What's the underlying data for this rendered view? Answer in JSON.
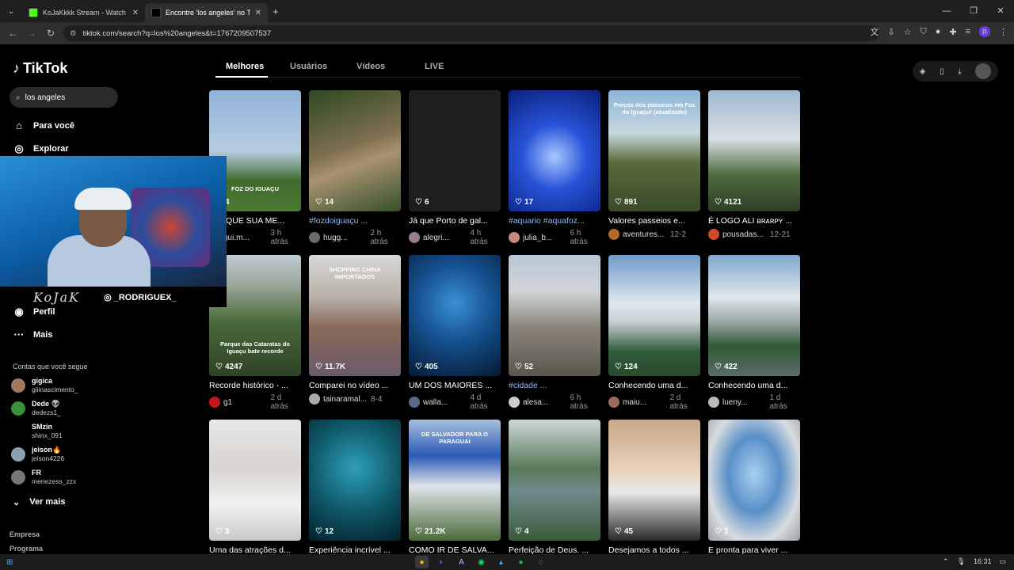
{
  "browser": {
    "tabs": [
      {
        "title": "KoJaKkkk Stream - Watch Live o",
        "favicon_color": "#53fc18"
      },
      {
        "title": "Encontre 'los angeles' no TikTok",
        "favicon_color": "#000000"
      }
    ],
    "url": "tiktok.com/search?q=los%20angeles&t=1767209507537",
    "profile_initial": "R"
  },
  "sidebar": {
    "brand": "TikTok",
    "search_value": "los angeles",
    "nav": [
      {
        "label": "Para você",
        "icon": "home-icon"
      },
      {
        "label": "Explorar",
        "icon": "compass-icon"
      },
      {
        "label": "Perfil",
        "icon": "user-icon"
      },
      {
        "label": "Mais",
        "icon": "more-icon"
      }
    ],
    "following_title": "Contas que você segue",
    "accounts": [
      {
        "name": "gigica",
        "user": "giiinascimento_",
        "color": "#a0775f"
      },
      {
        "name": "Dede 👽",
        "user": "dedezs1_",
        "color": "#3b8f3b"
      },
      {
        "name": "SMzin",
        "user": "shinx_091",
        "color": ""
      },
      {
        "name": "jeison🔥",
        "user": "jeison4226",
        "color": "#8aa0b0"
      },
      {
        "name": "FR",
        "user": "menezess_zzx",
        "color": "#777"
      }
    ],
    "see_more": "Ver mais",
    "footer": [
      "Empresa",
      "Programa"
    ]
  },
  "webcam": {
    "signature": "KoJaK",
    "instagram": "_RODRIGUEX_"
  },
  "search_tabs": [
    "Melhores",
    "Usuários",
    "Vídeos",
    "LIVE"
  ],
  "videos": [
    {
      "likes": "4",
      "caption": "BLOQUE SUA ME...",
      "author": "gui.m...",
      "date": "3 h atrás",
      "tag": false,
      "bg": "linear-gradient(180deg,#8fb3d9 0%,#b8cce0 50%,#3e6b2c 75%,#4c7a34 100%)",
      "overlay": "FOZ DO IGUAÇU",
      "av": "#888"
    },
    {
      "likes": "14",
      "caption": "#fozdoiguaçu ...",
      "author": "hugg...",
      "date": "2 h atrás",
      "tag": true,
      "bg": "linear-gradient(160deg,#2d4a22 0%,#7d6e4e 45%,#a89270 60%,#35502a 100%)",
      "overlay": "",
      "av": "#6a6a6a"
    },
    {
      "likes": "6",
      "caption": "Já que Porto de gal...",
      "author": "alegri...",
      "date": "4 h atrás",
      "tag": false,
      "bg": "#1e1e1e",
      "overlay": "",
      "av": "#9a7c8c"
    },
    {
      "likes": "17",
      "caption": "#aquario #aquafoz...",
      "author": "julia_b...",
      "date": "6 h atrás",
      "tag": true,
      "bg": "radial-gradient(circle at 50% 55%,#a9c8ff 0%,#2753d8 40%,#0a1f7a 100%)",
      "overlay": "",
      "av": "#c48a7a"
    },
    {
      "likes": "891",
      "caption": "Valores passeios e...",
      "author": "aventures...",
      "date": "12-2",
      "tag": false,
      "bg": "linear-gradient(180deg,#8ab4d8 0%,#c8d8e0 35%,#5a6a3a 60%,#3b4a2a 100%)",
      "overlay": "Preços dos passeios em Foz do Iguaçu! (atualizado)",
      "av": "#b06a2a"
    },
    {
      "likes": "4121",
      "caption": "É LOGO ALI ʙʀᴀʀᴘʏ ...",
      "author": "pousadas...",
      "date": "12-21",
      "tag": false,
      "bg": "linear-gradient(180deg,#9fb8cf 0%,#d8e0e4 40%,#4f6b3e 70%,#2d3f26 100%)",
      "overlay": "",
      "av": "#d04a2a"
    },
    {
      "likes": "4247",
      "caption": "Recorde histórico - ...",
      "author": "g1",
      "date": "2 d atrás",
      "tag": false,
      "bg": "linear-gradient(180deg,#c0ccd4 0%,#9aa69a 25%,#4a6a3a 55%,#2e4226 100%)",
      "overlay": "Parque das Cataratas do Iguaçu bate recorde",
      "av": "#c4161c"
    },
    {
      "likes": "11.7K",
      "caption": "Comparei no vídeo ...",
      "author": "tainaramal...",
      "date": "8-4",
      "tag": false,
      "bg": "linear-gradient(180deg,#d8d8d8 0%,#b8b0a8 35%,#8a6a5a 60%,#6a5a6a 100%)",
      "overlay": "SHOPPING CHINA IMPORTADOS",
      "av": "#aaa"
    },
    {
      "likes": "405",
      "caption": "UM DOS MAIORES ...",
      "author": "walla...",
      "date": "4 d atrás",
      "tag": false,
      "bg": "radial-gradient(circle at 50% 40%,#3a8fd8 0%,#15508f 45%,#061a33 100%)",
      "overlay": "",
      "av": "#5a6a8a"
    },
    {
      "likes": "52",
      "caption": "#cidade ...",
      "author": "alesa...",
      "date": "6 h atrás",
      "tag": true,
      "bg": "linear-gradient(180deg,#b8c8d8 0%,#d0d4d8 30%,#8a8478 60%,#5a564e 100%)",
      "overlay": "",
      "av": "#ccc"
    },
    {
      "likes": "124",
      "caption": "Conhecendo uma d...",
      "author": "maiu...",
      "date": "2 d atrás",
      "tag": false,
      "bg": "linear-gradient(180deg,#6f9ac8 0%,#e0e8ee 40%,#c8d0d4 55%,#2f5a3a 80%,#2a4a2e 100%)",
      "overlay": "",
      "av": "#9a6a5a"
    },
    {
      "likes": "422",
      "caption": "Conhecendo uma d...",
      "author": "lueny...",
      "date": "1 d atrás",
      "tag": false,
      "bg": "linear-gradient(180deg,#7fa8d0 0%,#e0e6ea 35%,#9aa8a8 55%,#2f5a34 75%,#5a6a6a 100%)",
      "overlay": "",
      "av": "#bbb"
    },
    {
      "likes": "3",
      "caption": "Uma das atrações d...",
      "author": "",
      "date": "",
      "tag": false,
      "bg": "linear-gradient(180deg,#e8e8e8 0%,#d8d4d0 40%,#f2f2f2 70%,#c8c8c8 100%)",
      "overlay": "",
      "av": "#777"
    },
    {
      "likes": "12",
      "caption": "Experiência incrível ...",
      "author": "",
      "date": "",
      "tag": false,
      "bg": "radial-gradient(circle at 50% 40%,#2f9fb8 0%,#0f5a6a 50%,#04202a 100%)",
      "overlay": "",
      "av": "#777"
    },
    {
      "likes": "21.2K",
      "caption": "COMO IR DE SALVA...",
      "author": "",
      "date": "",
      "tag": false,
      "bg": "linear-gradient(180deg,#a8c0dc 0%,#2a5ab8 30%,#e0e4ea 55%,#4a6a3a 100%)",
      "overlay": "DE SALVADOR PARA O PARAGUAI",
      "av": "#777"
    },
    {
      "likes": "4",
      "caption": "Perfeição de Deus. ...",
      "author": "",
      "date": "",
      "tag": false,
      "bg": "linear-gradient(180deg,#cfd8d8 0%,#5a7a5a 40%,#6f8a8a 60%,#3a5a3a 100%)",
      "overlay": "",
      "av": "#777"
    },
    {
      "likes": "45",
      "caption": "Desejamos a todos ...",
      "author": "",
      "date": "",
      "tag": false,
      "bg": "linear-gradient(180deg,#c8a888 0%,#e8d0b8 40%,#e8e8e8 60%,#2a2a2a 100%)",
      "overlay": "",
      "av": "#777"
    },
    {
      "likes": "1",
      "caption": "E pronta para viver ...",
      "author": "",
      "date": "",
      "tag": false,
      "bg": "radial-gradient(ellipse at 50% 45%,#a8d0f0 0%,#5a90c8 40%,#d8dce0 72%,#9aa0a8 100%)",
      "overlay": "",
      "av": "#777"
    }
  ],
  "taskbar": {
    "time": "16:31"
  }
}
